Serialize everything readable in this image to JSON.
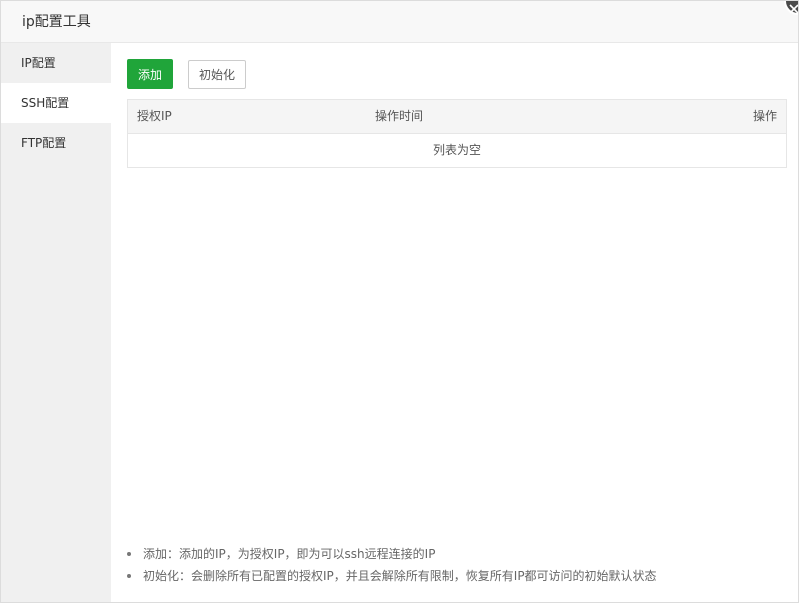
{
  "window": {
    "title": "ip配置工具"
  },
  "sidebar": {
    "items": [
      {
        "label": "IP配置",
        "active": false
      },
      {
        "label": "SSH配置",
        "active": true
      },
      {
        "label": "FTP配置",
        "active": false
      }
    ]
  },
  "toolbar": {
    "add_label": "添加",
    "init_label": "初始化"
  },
  "table": {
    "columns": [
      "授权IP",
      "操作时间",
      "操作"
    ],
    "empty_text": "列表为空"
  },
  "tips": [
    "添加：添加的IP，为授权IP，即为可以ssh远程连接的IP",
    "初始化：会删除所有已配置的授权IP，并且会解除所有限制，恢复所有IP都可访问的初始默认状态"
  ],
  "colors": {
    "primary": "#20a53a",
    "sidebar_bg": "#f0f0f0",
    "header_bg": "#f5f5f5"
  },
  "icons": {
    "close": "close-icon"
  }
}
